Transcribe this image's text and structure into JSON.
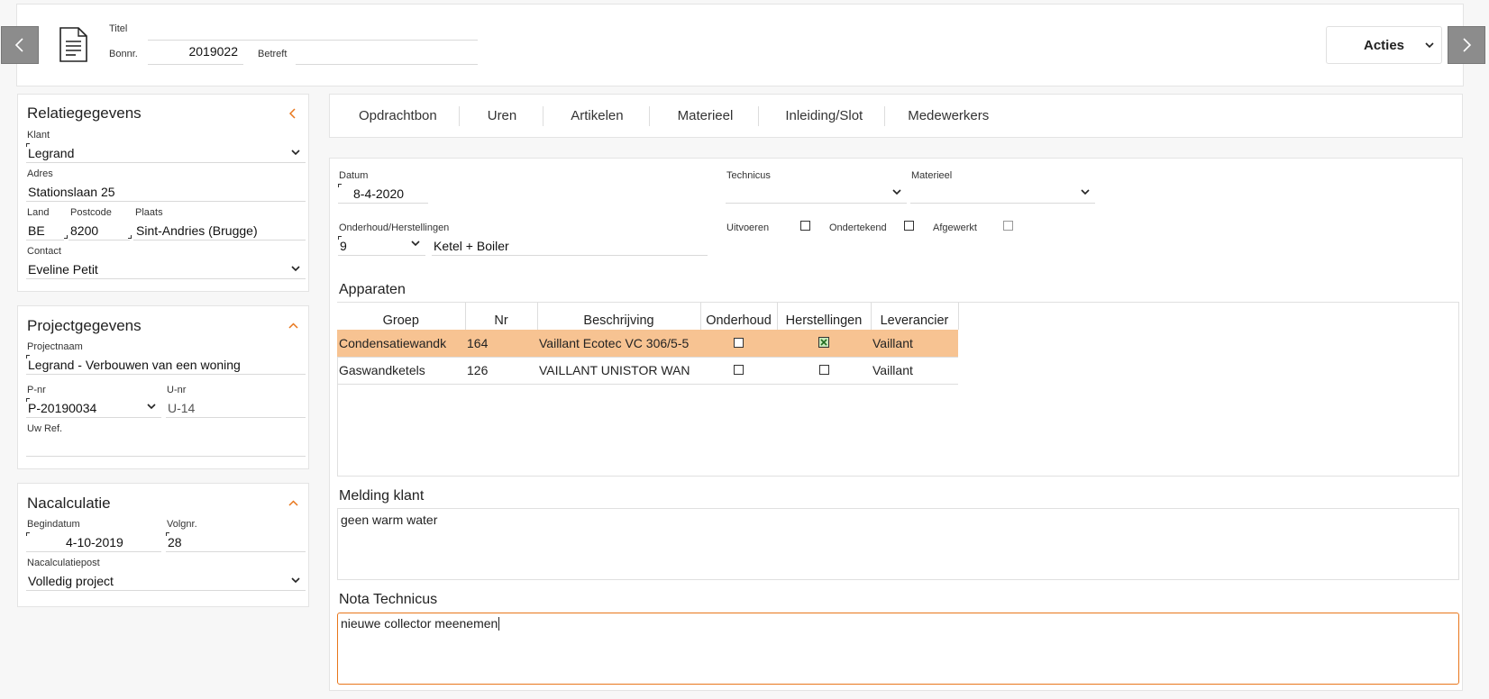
{
  "header": {
    "title_label": "Titel",
    "title_value": "",
    "bonnr_label": "Bonnr.",
    "bonnr_value": "2019022",
    "betreft_label": "Betreft",
    "betreft_value": "",
    "actions_label": "Acties",
    "prev_icon": "chevron-left-icon",
    "next_icon": "chevron-right-icon",
    "doc_icon": "document-icon"
  },
  "relatie": {
    "title": "Relatiegegevens",
    "klant_label": "Klant",
    "klant_value": "Legrand",
    "adres_label": "Adres",
    "adres_value": "Stationslaan 25",
    "land_label": "Land",
    "land_value": "BE",
    "postcode_label": "Postcode",
    "postcode_value": "8200",
    "plaats_label": "Plaats",
    "plaats_value": "Sint-Andries (Brugge)",
    "contact_label": "Contact",
    "contact_value": "Eveline Petit"
  },
  "project": {
    "title": "Projectgegevens",
    "naam_label": "Projectnaam",
    "naam_value": "Legrand - Verbouwen van een woning",
    "pnr_label": "P-nr",
    "pnr_value": "P-20190034",
    "unr_label": "U-nr",
    "unr_value": "U-14",
    "ref_label": "Uw Ref.",
    "ref_value": ""
  },
  "nacalculatie": {
    "title": "Nacalculatie",
    "begindatum_label": "Begindatum",
    "begindatum_value": "4-10-2019",
    "volgnr_label": "Volgnr.",
    "volgnr_value": "28",
    "post_label": "Nacalculatiepost",
    "post_value": "Volledig project"
  },
  "tabs": [
    "Opdrachtbon",
    "Uren",
    "Artikelen",
    "Materieel",
    "Inleiding/Slot",
    "Medewerkers"
  ],
  "form": {
    "datum_label": "Datum",
    "datum_value": "8-4-2020",
    "technicus_label": "Technicus",
    "technicus_value": "",
    "materieel_label": "Materieel",
    "materieel_value": "",
    "onderhoud_label": "Onderhoud/Herstellingen",
    "onderhoud_code": "9",
    "onderhoud_desc": "Ketel + Boiler",
    "uitvoeren_label": "Uitvoeren",
    "ondertekend_label": "Ondertekend",
    "afgewerkt_label": "Afgewerkt"
  },
  "apparaten": {
    "title": "Apparaten",
    "columns": [
      "Groep",
      "Nr",
      "Beschrijving",
      "Onderhoud",
      "Herstellingen",
      "Leverancier"
    ],
    "rows": [
      {
        "groep": "Condensatiewandk",
        "nr": "164",
        "beschrijving": "Vaillant Ecotec VC 306/5-5",
        "onderhoud": false,
        "herstellingen": true,
        "leverancier": "Vaillant"
      },
      {
        "groep": "Gaswandketels",
        "nr": "126",
        "beschrijving": "VAILLANT UNISTOR WAN",
        "onderhoud": false,
        "herstellingen": false,
        "leverancier": "Vaillant"
      }
    ]
  },
  "melding": {
    "title": "Melding klant",
    "value": "geen warm water"
  },
  "nota": {
    "title": "Nota Technicus",
    "value": "nieuwe collector meenemen"
  },
  "colors": {
    "accent": "#e8761b",
    "selected_row": "#f7c392",
    "nav_button": "#8c8c8c"
  }
}
